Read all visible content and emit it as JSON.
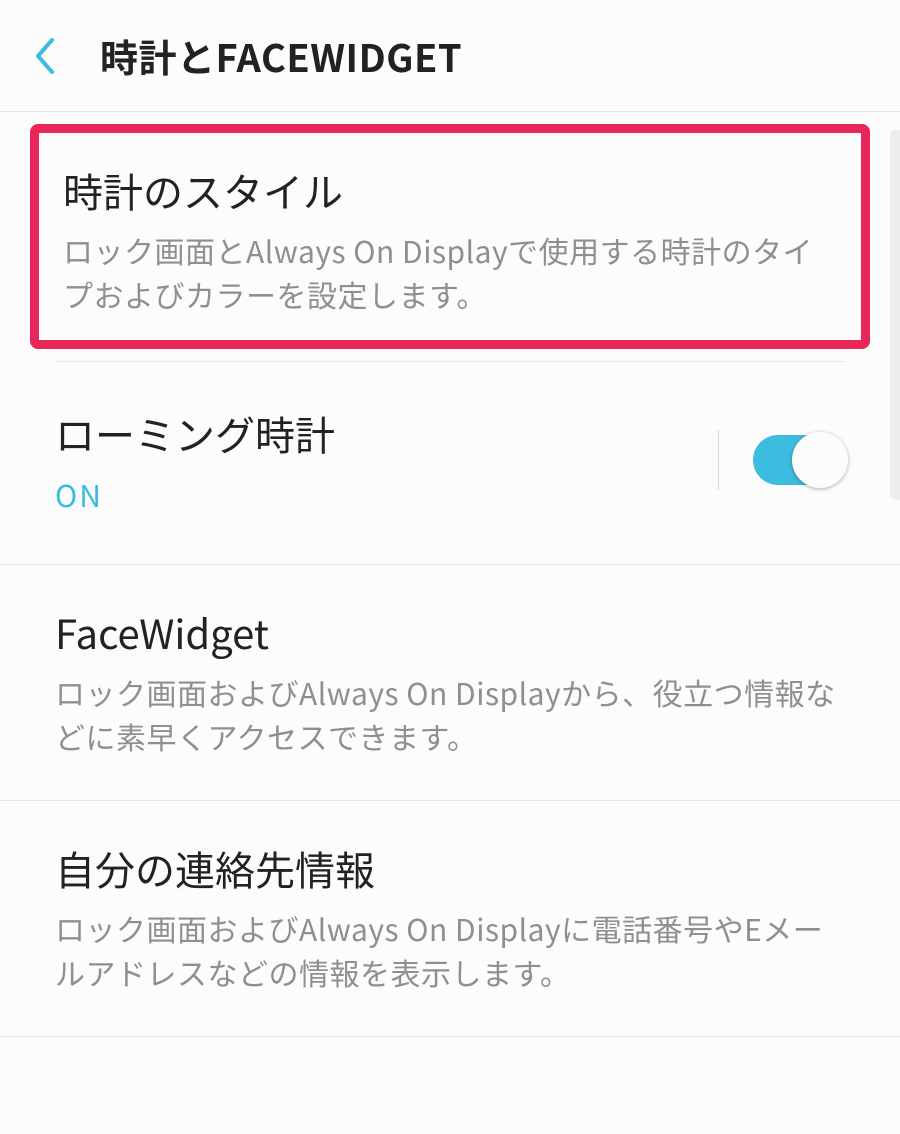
{
  "header": {
    "title": "時計とFACEWIDGET"
  },
  "items": {
    "clockStyle": {
      "title": "時計のスタイル",
      "desc": "ロック画面とAlways On Displayで使用する時計のタイプおよびカラーを設定します。"
    },
    "roaming": {
      "title": "ローミング時計",
      "status": "ON"
    },
    "faceWidget": {
      "title": "FaceWidget",
      "desc": "ロック画面およびAlways On Displayから、役立つ情報などに素早くアクセスできます。"
    },
    "contactInfo": {
      "title": "自分の連絡先情報",
      "desc": "ロック画面およびAlways On Displayに電話番号やEメールアドレスなどの情報を表示します。"
    }
  }
}
